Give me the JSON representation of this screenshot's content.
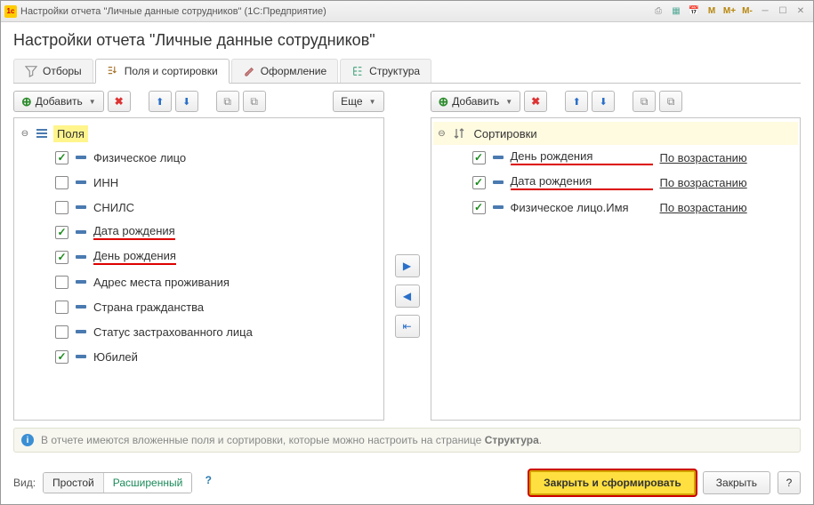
{
  "window": {
    "title": "Настройки отчета \"Личные данные сотрудников\"  (1С:Предприятие)"
  },
  "page_title": "Настройки отчета \"Личные данные сотрудников\"",
  "tabs": {
    "filters": "Отборы",
    "fields": "Поля и сортировки",
    "appearance": "Оформление",
    "structure": "Структура"
  },
  "toolbar": {
    "add": "Добавить",
    "more": "Еще"
  },
  "fields_panel": {
    "root_label": "Поля",
    "items": [
      {
        "label": "Физическое лицо",
        "checked": true,
        "mark": false
      },
      {
        "label": "ИНН",
        "checked": false,
        "mark": false
      },
      {
        "label": "СНИЛС",
        "checked": false,
        "mark": false
      },
      {
        "label": "Дата рождения",
        "checked": true,
        "mark": true
      },
      {
        "label": "День рождения",
        "checked": true,
        "mark": true
      },
      {
        "label": "Адрес места проживания",
        "checked": false,
        "mark": false
      },
      {
        "label": "Страна гражданства",
        "checked": false,
        "mark": false
      },
      {
        "label": "Статус застрахованного лица",
        "checked": false,
        "mark": false
      },
      {
        "label": "Юбилей",
        "checked": true,
        "mark": false
      }
    ]
  },
  "sort_panel": {
    "root_label": "Сортировки",
    "items": [
      {
        "label": "День рождения",
        "checked": true,
        "mark": true,
        "order": "По возрастанию"
      },
      {
        "label": "Дата рождения",
        "checked": true,
        "mark": true,
        "order": "По возрастанию"
      },
      {
        "label": "Физическое лицо.Имя",
        "checked": true,
        "mark": false,
        "order": "По возрастанию"
      }
    ]
  },
  "info": {
    "text_pre": "В отчете имеются вложенные поля и сортировки, которые можно настроить на странице ",
    "text_bold": "Структура",
    "text_post": "."
  },
  "footer": {
    "view_label": "Вид:",
    "simple": "Простой",
    "advanced": "Расширенный",
    "close_generate": "Закрыть и сформировать",
    "close": "Закрыть",
    "help": "?"
  }
}
